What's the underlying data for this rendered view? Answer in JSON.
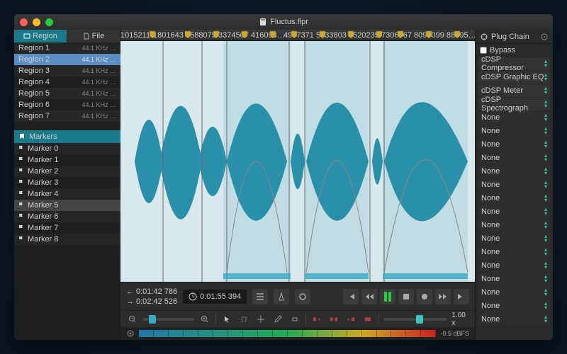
{
  "window": {
    "title": "Fluctus.flpr"
  },
  "sidebar": {
    "tabs": [
      {
        "label": "Region",
        "active": true
      },
      {
        "label": "File",
        "active": false
      }
    ],
    "regions": [
      {
        "name": "Region 1",
        "rate": "44.1 KHz …",
        "selected": false
      },
      {
        "name": "Region 2",
        "rate": "44.1 KHz …",
        "selected": true
      },
      {
        "name": "Region 3",
        "rate": "44.1 KHz …",
        "selected": false
      },
      {
        "name": "Region 4",
        "rate": "44.1 KHz …",
        "selected": false
      },
      {
        "name": "Region 5",
        "rate": "44.1 KHz …",
        "selected": false
      },
      {
        "name": "Region 6",
        "rate": "44.1 KHz …",
        "selected": false
      },
      {
        "name": "Region 7",
        "rate": "44.1 KHz …",
        "selected": false
      }
    ],
    "markers_header": "Markers",
    "markers": [
      {
        "name": "Marker 0"
      },
      {
        "name": "Marker 1"
      },
      {
        "name": "Marker 2"
      },
      {
        "name": "Marker 3"
      },
      {
        "name": "Marker 4"
      },
      {
        "name": "Marker 5",
        "selected": true
      },
      {
        "name": "Marker 6"
      },
      {
        "name": "Marker 7"
      },
      {
        "name": "Marker 8"
      }
    ]
  },
  "ruler": {
    "ticks": [
      "1015211",
      "1801643",
      "2588075",
      "3374507",
      "416093…",
      "4947371",
      "5733803",
      "6520235",
      "7306667",
      "8093099",
      "88795…"
    ]
  },
  "transport": {
    "in_time": "0:01:42 786",
    "out_time": "0:02:42 526",
    "main_time": "0:01:55 394",
    "speed": "1.00 x"
  },
  "meter": {
    "value": "-0.5 dBFS"
  },
  "plugchain": {
    "title": "Plug Chain",
    "bypass_label": "Bypass",
    "slots": [
      {
        "label": "cDSP Compressor",
        "filled": true
      },
      {
        "label": "cDSP Graphic EQ",
        "filled": true
      },
      {
        "label": "cDSP Meter",
        "filled": true
      },
      {
        "label": "cDSP Spectrograph",
        "filled": true
      },
      {
        "label": "None"
      },
      {
        "label": "None"
      },
      {
        "label": "None"
      },
      {
        "label": "None"
      },
      {
        "label": "None"
      },
      {
        "label": "None"
      },
      {
        "label": "None"
      },
      {
        "label": "None"
      },
      {
        "label": "None"
      },
      {
        "label": "None"
      },
      {
        "label": "None"
      },
      {
        "label": "None"
      },
      {
        "label": "None"
      },
      {
        "label": "None"
      },
      {
        "label": "None"
      },
      {
        "label": "None"
      }
    ]
  },
  "icons": {
    "gear": "gear",
    "close": "close",
    "flag": "flag",
    "clock": "clock"
  }
}
